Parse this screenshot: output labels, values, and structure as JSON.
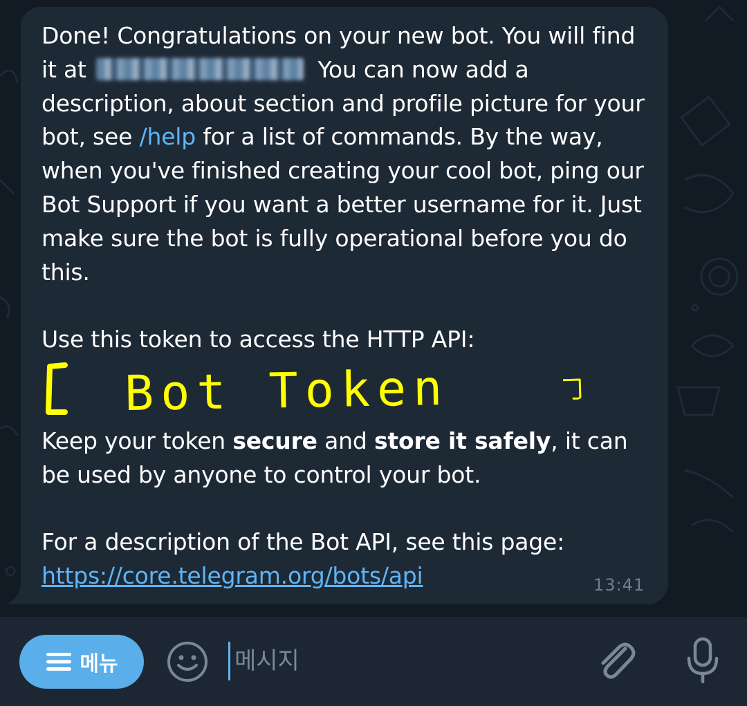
{
  "colors": {
    "chat_background": "#121a24",
    "bubble": "#1e2936",
    "text": "#ffffff",
    "link": "#5eb5f7",
    "highlight_token": "#ffff00",
    "time": "#6d7f8f",
    "input_bar": "#1c2733",
    "menu_button": "#5aaee9"
  },
  "message": {
    "p1_start": "Done! Congratulations on your new bot. You will find it at",
    "p1_after_redacted": "You can now add a description, about section and profile picture for your bot, see",
    "help_command": "/help",
    "p1_end": "for a list of commands. By the way, when you've finished creating your cool bot, ping our Bot Support if you want a better username for it. Just make sure the bot is fully operational before you do this.",
    "p2": "Use this token to access the HTTP API:",
    "token_placeholder": "Bot Token",
    "p3_start": "Keep your token",
    "p3_bold1": "secure",
    "p3_mid": "and",
    "p3_bold2": "store it safely",
    "p3_end": ", it can be used by anyone to control your bot.",
    "p4": "For a description of the Bot API, see this page:",
    "api_link": "https://core.telegram.org/bots/api",
    "time": "13:41"
  },
  "input_bar": {
    "menu_label": "메뉴",
    "placeholder": "메시지",
    "icons": [
      "hamburger-icon",
      "emoji-icon",
      "paperclip-icon",
      "microphone-icon"
    ]
  }
}
